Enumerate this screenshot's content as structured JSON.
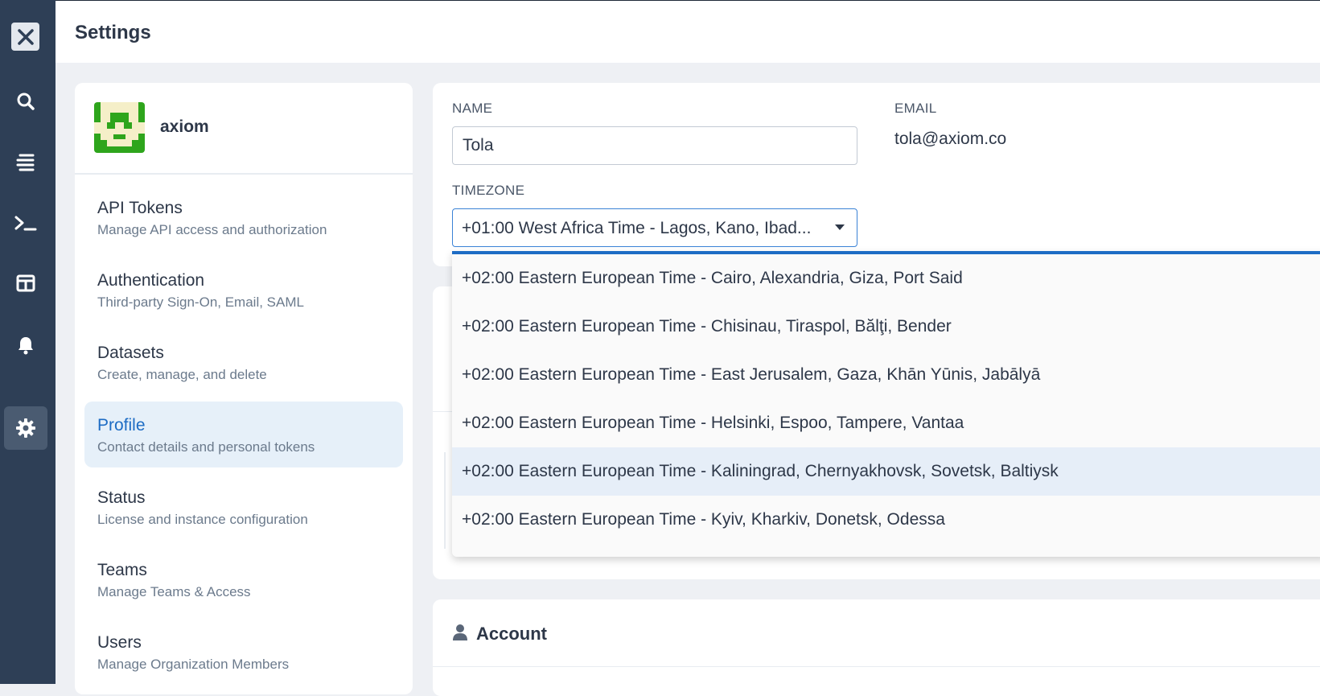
{
  "app": {
    "title": "Settings"
  },
  "rail": {
    "items": [
      {
        "name": "close",
        "icon": "close-icon"
      },
      {
        "name": "search",
        "icon": "search-icon"
      },
      {
        "name": "datasets",
        "icon": "stream-icon"
      },
      {
        "name": "query",
        "icon": "terminal-icon"
      },
      {
        "name": "dashboards",
        "icon": "layout-icon"
      },
      {
        "name": "monitors",
        "icon": "bell-icon"
      },
      {
        "name": "settings",
        "icon": "gear-icon",
        "active": true
      }
    ]
  },
  "org": {
    "name": "axiom",
    "avatar_colors": {
      "primary": "#2ea51c",
      "secondary": "#f5efc8"
    }
  },
  "nav": {
    "items": [
      {
        "label": "API Tokens",
        "desc": "Manage API access and authorization"
      },
      {
        "label": "Authentication",
        "desc": "Third-party Sign-On, Email, SAML"
      },
      {
        "label": "Datasets",
        "desc": "Create, manage, and delete"
      },
      {
        "label": "Profile",
        "desc": "Contact details and personal tokens",
        "active": true
      },
      {
        "label": "Status",
        "desc": "License and instance configuration"
      },
      {
        "label": "Teams",
        "desc": "Manage Teams & Access"
      },
      {
        "label": "Users",
        "desc": "Manage Organization Members"
      }
    ]
  },
  "profile": {
    "name_label": "NAME",
    "name_value": "Tola",
    "email_label": "EMAIL",
    "email_value": "tola@axiom.co",
    "timezone_label": "TIMEZONE",
    "timezone_value": "+01:00 West Africa Time - Lagos, Kano, Ibad..."
  },
  "timezone_dropdown": {
    "options": [
      "+02:00 Eastern European Time - Cairo, Alexandria, Giza, Port Said",
      "+02:00 Eastern European Time - Chisinau, Tiraspol, Bălţi, Bender",
      "+02:00 Eastern European Time - East Jerusalem, Gaza, Khān Yūnis, Jabālyā",
      "+02:00 Eastern European Time - Helsinki, Espoo, Tampere, Vantaa",
      "+02:00 Eastern European Time - Kaliningrad, Chernyakhovsk, Sovetsk, Baltiysk",
      "+02:00 Eastern European Time - Kyiv, Kharkiv, Donetsk, Odessa"
    ],
    "highlighted_index": 4
  },
  "account": {
    "title": "Account",
    "icon": "user-icon"
  },
  "colors": {
    "rail_bg": "#2e3f56",
    "accent": "#1d6cc4",
    "active_nav_bg": "#e6f0f9"
  }
}
